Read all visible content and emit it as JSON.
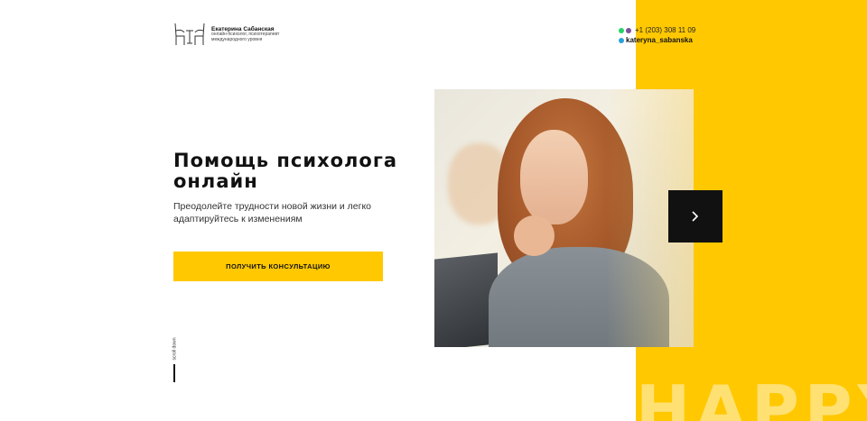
{
  "brand": {
    "name": "Екатерина Сабанская",
    "tagline": "онлайн-психолог, психотерапевт международного уровня"
  },
  "contacts": {
    "phone": "+1 (203) 308 11 09",
    "telegram": "kateryna_sabanska",
    "icons": [
      "whatsapp-icon",
      "viber-icon",
      "telegram-icon"
    ]
  },
  "hero": {
    "title": "Помощь психолога онлайн",
    "subtitle": "Преодолейте трудности новой жизни и легко адаптируйтесь к изменениям",
    "cta_label": "ПОЛУЧИТЬ КОНСУЛЬТАЦИЮ"
  },
  "scroll": {
    "label": "scroll down"
  },
  "decor": {
    "big_word": "HAPPY"
  },
  "colors": {
    "accent": "#ffc800",
    "dark": "#111111",
    "background": "#ffffff"
  }
}
